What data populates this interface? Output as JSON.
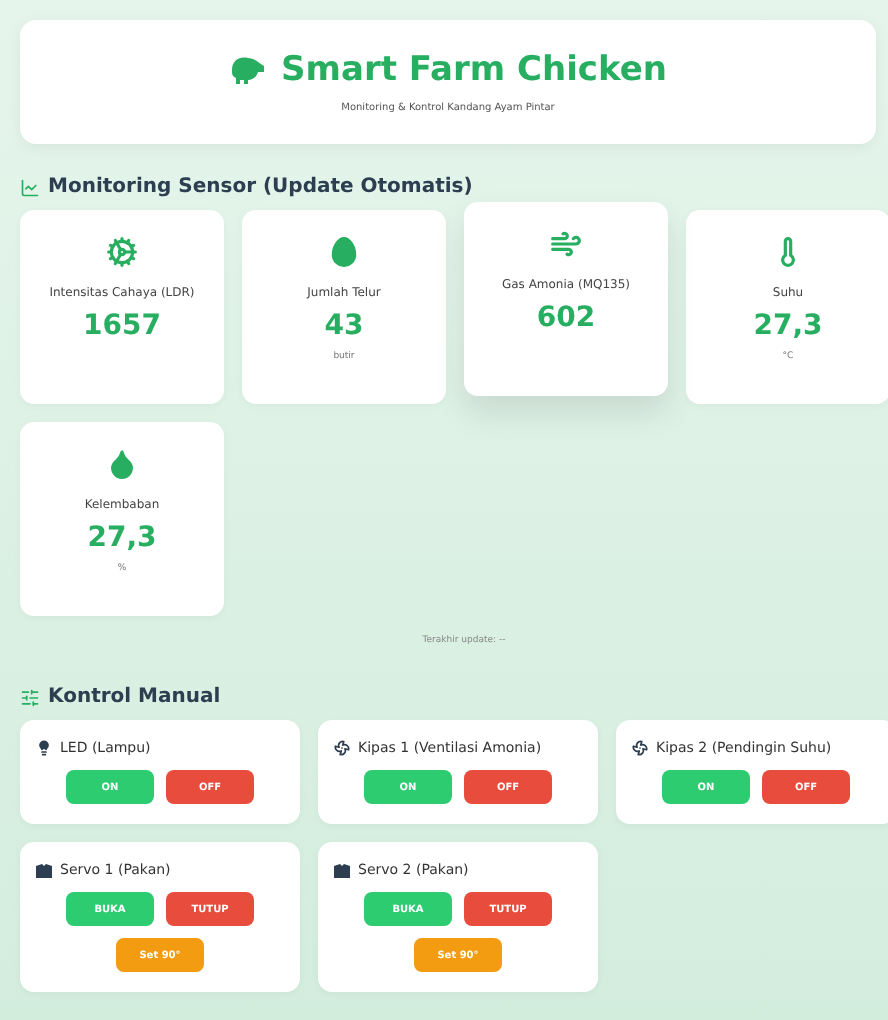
{
  "header": {
    "title": "Smart Farm Chicken",
    "subtitle": "Monitoring & Kontrol Kandang Ayam Pintar"
  },
  "sensor_section": {
    "title": "Monitoring Sensor (Update Otomatis)",
    "cards": [
      {
        "kind": "light",
        "label": "Intensitas Cahaya (LDR)",
        "value": "1657",
        "raised": false
      },
      {
        "kind": "eggs",
        "label": "Jumlah Telur",
        "value": "43",
        "unit": "butir",
        "raised": false
      },
      {
        "kind": "gas",
        "label": "Gas Amonia (MQ135)",
        "value": "602",
        "raised": true
      },
      {
        "kind": "temperature",
        "label": "Suhu",
        "value": "27,3",
        "unit": "°C",
        "raised": false
      },
      {
        "kind": "humidity",
        "label": "Kelembaban",
        "value": "27,3",
        "unit": "%",
        "raised": false
      }
    ],
    "last_update": "Terakhir update: --"
  },
  "control_section": {
    "title": "Kontrol Manual",
    "devices": [
      {
        "kind": "lamp",
        "name": "LED (Lampu)",
        "buttons": [
          {
            "label": "ON",
            "kind": "on"
          },
          {
            "label": "OFF",
            "kind": "off"
          }
        ]
      },
      {
        "kind": "fan",
        "name": "Kipas 1 (Ventilasi Amonia)",
        "buttons": [
          {
            "label": "ON",
            "kind": "on"
          },
          {
            "label": "OFF",
            "kind": "off"
          }
        ]
      },
      {
        "kind": "fan",
        "name": "Kipas 2 (Pendingin Suhu)",
        "buttons": [
          {
            "label": "ON",
            "kind": "on"
          },
          {
            "label": "OFF",
            "kind": "off"
          }
        ]
      },
      {
        "kind": "servo",
        "name": "Servo 1 (Pakan)",
        "buttons": [
          {
            "label": "BUKA",
            "kind": "on"
          },
          {
            "label": "TUTUP",
            "kind": "off"
          },
          {
            "label": "Set 90°",
            "kind": "set"
          }
        ]
      },
      {
        "kind": "servo",
        "name": "Servo 2 (Pakan)",
        "buttons": [
          {
            "label": "BUKA",
            "kind": "on"
          },
          {
            "label": "TUTUP",
            "kind": "off"
          },
          {
            "label": "Set 90°",
            "kind": "set"
          }
        ]
      }
    ]
  }
}
